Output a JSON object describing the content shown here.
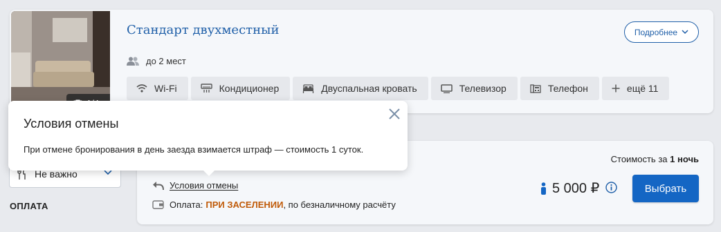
{
  "room": {
    "photo_count": "1/4",
    "title": "Стандарт двухместный",
    "more_label": "Подробнее",
    "capacity": "до 2 мест",
    "amenities": [
      {
        "label": "Wi-Fi",
        "icon": "wifi-icon"
      },
      {
        "label": "Кондиционер",
        "icon": "air-conditioner-icon"
      },
      {
        "label": "Двуспальная кровать",
        "icon": "double-bed-icon"
      },
      {
        "label": "Телевизор",
        "icon": "tv-icon"
      },
      {
        "label": "Телефон",
        "icon": "phone-icon"
      },
      {
        "label": "ещё 11",
        "icon": "plus-icon"
      }
    ]
  },
  "tooltip": {
    "title": "Условия отмены",
    "text": "При отмене бронирования в день заезда взимается штраф — стоимость 1 суток."
  },
  "filter": {
    "meal_value": "Не важно",
    "payment_section": "ОПЛАТА"
  },
  "offer": {
    "price_caption_prefix": "Стоимость за",
    "price_caption_bold": "1 ночь",
    "cancel_label": "Условия отмены",
    "payment_prefix": "Оплата:",
    "payment_accent": "ПРИ ЗАСЕЛЕНИИ",
    "payment_suffix": ", по безналичному расчёту",
    "price": "5 000 ₽",
    "select_label": "Выбрать"
  },
  "colors": {
    "brand_blue": "#1f5fa8",
    "button_blue": "#1466c4",
    "payment_accent": "#c05a08",
    "background": "#e8eaee"
  }
}
